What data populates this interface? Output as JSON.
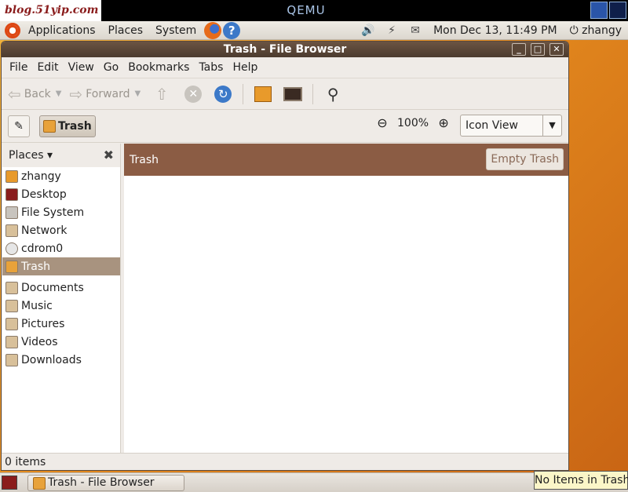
{
  "qemu": {
    "blog_logo": "blog.51yip.com",
    "title": "QEMU"
  },
  "top_panel": {
    "applications": "Applications",
    "places": "Places",
    "system": "System",
    "datetime": "Mon Dec 13, 11:49 PM",
    "user": "zhangy"
  },
  "window": {
    "title": "Trash - File Browser",
    "menus": [
      "File",
      "Edit",
      "View",
      "Go",
      "Bookmarks",
      "Tabs",
      "Help"
    ],
    "toolbar": {
      "back": "Back",
      "forward": "Forward"
    },
    "location": {
      "crumb": "Trash",
      "zoom": "100%",
      "view_mode": "Icon View"
    },
    "sidebar": {
      "header": "Places",
      "items": [
        "zhangy",
        "Desktop",
        "File System",
        "Network",
        "cdrom0",
        "Trash",
        "Documents",
        "Music",
        "Pictures",
        "Videos",
        "Downloads"
      ],
      "selected": "Trash"
    },
    "content": {
      "bar_label": "Trash",
      "empty_button": "Empty Trash"
    },
    "status": "0 items"
  },
  "bottom_panel": {
    "task": "Trash - File Browser",
    "tooltip": "No Items in Trash"
  }
}
